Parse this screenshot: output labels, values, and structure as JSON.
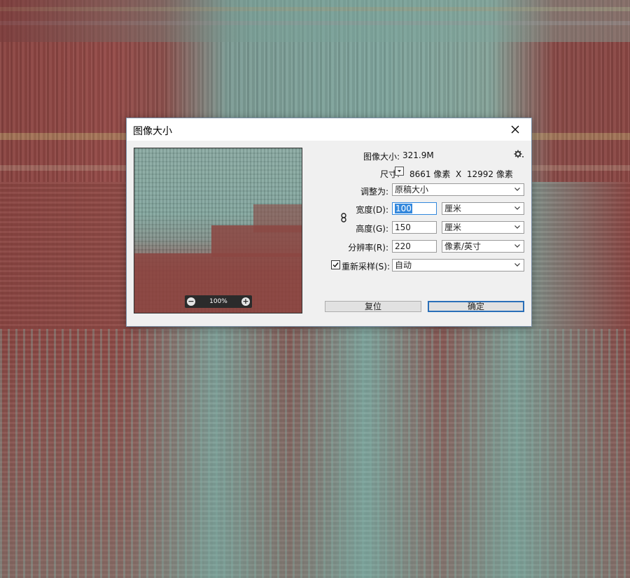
{
  "dialog": {
    "title": "图像大小",
    "image_size_label": "图像大小:",
    "image_size_value": "321.9M",
    "dimensions_label": "尺寸:",
    "dimensions_value": "8661 像素  X  12992 像素",
    "fit_to_label": "调整为:",
    "fit_to_value": "原稿大小",
    "width_label": "宽度(D):",
    "width_value": "100",
    "width_unit": "厘米",
    "height_label": "高度(G):",
    "height_value": "150",
    "height_unit": "厘米",
    "resolution_label": "分辨率(R):",
    "resolution_value": "220",
    "resolution_unit": "像素/英寸",
    "resample_label": "重新采样(S):",
    "resample_checked": true,
    "resample_value": "自动",
    "reset_button": "复位",
    "ok_button": "确定",
    "zoom_value": "100%"
  },
  "icons": {
    "close": "close-icon",
    "settings": "gear-icon",
    "link": "chain-link-icon",
    "dimensions_dropdown": "chevron-down-icon",
    "zoom_out": "zoom-out-icon",
    "zoom_in": "zoom-in-icon"
  },
  "colors": {
    "accent": "#2a6fb8",
    "selection": "#3388dd"
  }
}
